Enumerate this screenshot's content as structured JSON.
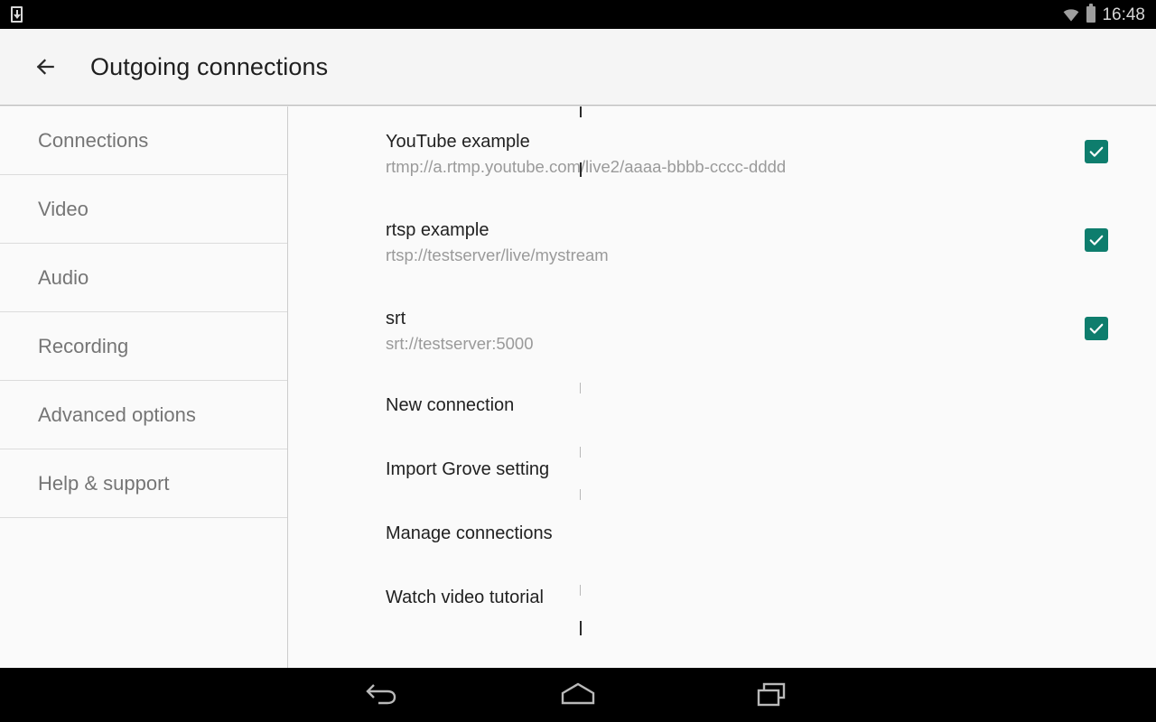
{
  "status_bar": {
    "download_icon": "download-icon",
    "wifi_icon": "wifi-icon",
    "battery_icon": "battery-icon",
    "time": "16:48"
  },
  "app_bar": {
    "back_icon": "arrow-left-icon",
    "title": "Outgoing connections"
  },
  "sidebar": {
    "items": [
      {
        "label": "Connections"
      },
      {
        "label": "Video"
      },
      {
        "label": "Audio"
      },
      {
        "label": "Recording"
      },
      {
        "label": "Advanced options"
      },
      {
        "label": "Help & support"
      }
    ]
  },
  "main": {
    "accent_color": "#0e7d6d",
    "connections": [
      {
        "name": "YouTube example",
        "url": "rtmp://a.rtmp.youtube.com/live2/aaaa-bbbb-cccc-dddd",
        "enabled": true
      },
      {
        "name": "rtsp example",
        "url": "rtsp://testserver/live/mystream",
        "enabled": true
      },
      {
        "name": "srt",
        "url": "srt://testserver:5000",
        "enabled": true
      }
    ],
    "actions": [
      {
        "label": "New connection"
      },
      {
        "label": "Import Grove setting"
      },
      {
        "label": "Manage connections"
      },
      {
        "label": "Watch video tutorial"
      }
    ]
  },
  "nav_bar": {
    "back_icon": "nav-back-icon",
    "home_icon": "nav-home-icon",
    "recents_icon": "nav-recents-icon"
  }
}
